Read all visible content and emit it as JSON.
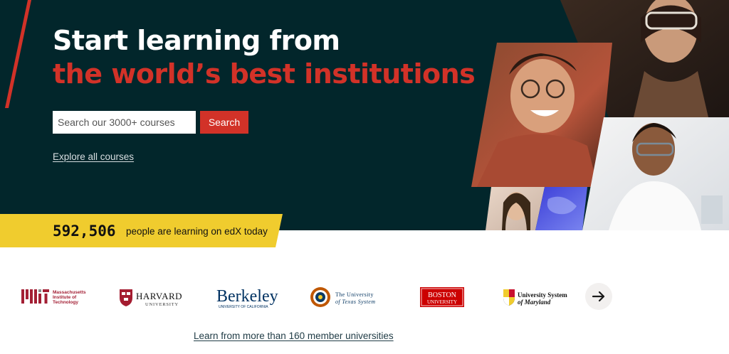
{
  "hero": {
    "headline_line1": "Start learning from",
    "headline_line2": "the world’s best institutions",
    "search_placeholder": "Search our 3000+ courses",
    "search_button": "Search",
    "explore_link": "Explore all courses",
    "learner_count": "592,506",
    "learner_text": "people are learning on edX today"
  },
  "partners": {
    "logos": [
      {
        "name": "MIT",
        "line1": "Massachusetts",
        "line2": "Institute of",
        "line3": "Technology"
      },
      {
        "name": "HARVARD",
        "sub": "UNIVERSITY"
      },
      {
        "name": "Berkeley",
        "sub": "UNIVERSITY OF CALIFORNIA"
      },
      {
        "name": "The University",
        "sub": "of Texas System"
      },
      {
        "name": "BOSTON",
        "sub": "UNIVERSITY"
      },
      {
        "name": "University System",
        "sub": "of Maryland"
      }
    ],
    "member_link": "Learn from more than 160 member universities"
  },
  "colors": {
    "hero_bg": "#02262b",
    "accent_red": "#d23228",
    "yellow": "#f0cc2e"
  }
}
